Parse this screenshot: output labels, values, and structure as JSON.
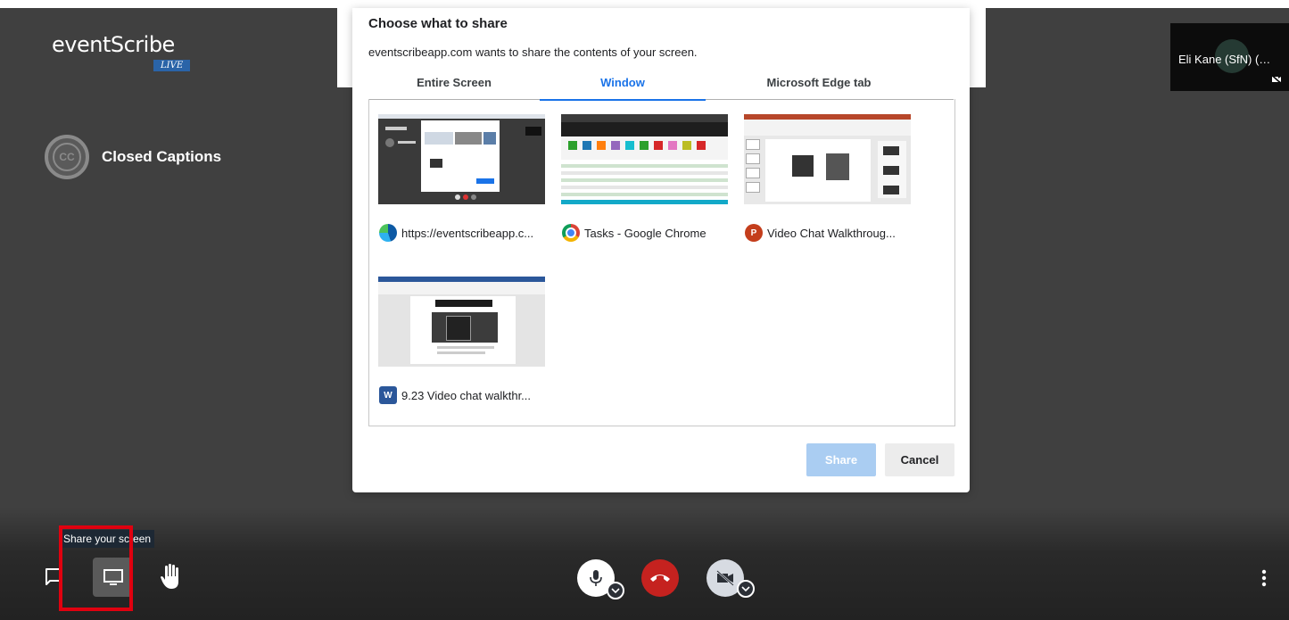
{
  "branding": {
    "logo_text": "eventScribe",
    "logo_badge": "LIVE"
  },
  "captions": {
    "label": "Closed Captions",
    "icon_text": "CC"
  },
  "participant": {
    "name": "Eli Kane (SfN) (…"
  },
  "share_dialog": {
    "title": "Choose what to share",
    "subtitle": "eventscribeapp.com wants to share the contents of your screen.",
    "tabs": [
      {
        "label": "Entire Screen",
        "active": false
      },
      {
        "label": "Window",
        "active": true
      },
      {
        "label": "Microsoft Edge tab",
        "active": false
      }
    ],
    "windows": [
      {
        "label": "https://eventscribeapp.c...",
        "app_icon": "edge-icon"
      },
      {
        "label": "Tasks - Google Chrome",
        "app_icon": "chrome-icon"
      },
      {
        "label": "Video Chat Walkthroug...",
        "app_icon": "powerpoint-icon"
      },
      {
        "label": "9.23 Video chat walkthr...",
        "app_icon": "word-icon"
      }
    ],
    "share_button": "Share",
    "cancel_button": "Cancel"
  },
  "toolbar": {
    "tooltip": "Share your screen"
  },
  "colors": {
    "accent": "#1a73e8",
    "highlight": "#e0000f",
    "hangup": "#c5221f",
    "stage": "#404040"
  }
}
